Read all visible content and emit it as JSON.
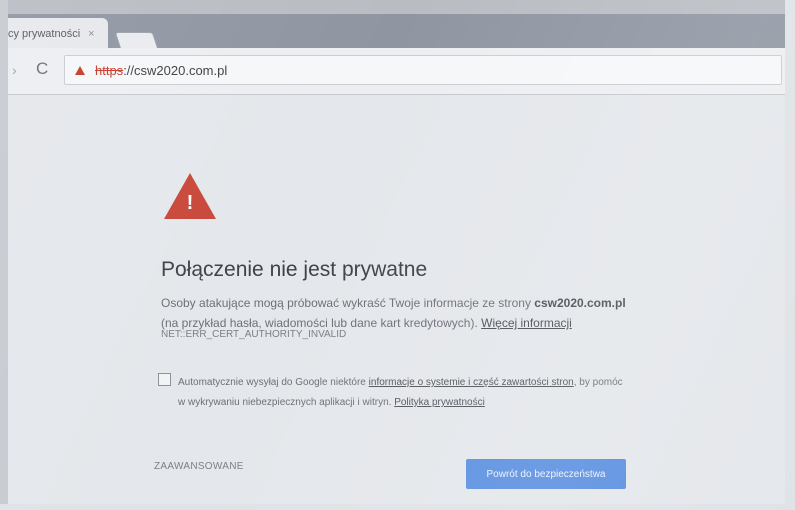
{
  "browser": {
    "tab_title": "cy prywatności",
    "tab_close": "×",
    "nav_forward": "›",
    "nav_reload": "C",
    "url_scheme": "https",
    "url_rest": "://csw2020.com.pl"
  },
  "page": {
    "heading": "Połączenie nie jest prywatne",
    "body_prefix": "Osoby atakujące mogą próbować wykraść Twoje informacje ze strony",
    "body_domain": "csw2020.com.pl",
    "body_suffix": "(na przykład hasła, wiadomości lub dane kart kredytowych).",
    "more_info_link": "Więcej informacji",
    "error_code": "NET::ERR_CERT_AUTHORITY_INVALID",
    "warning_mark": "!",
    "optin_prefix": "Automatycznie wysyłaj do Google niektóre",
    "optin_link": "informacje o systemie i część zawartości stron",
    "optin_middle": ", by pomóc w wykrywaniu niebezpiecznych aplikacji i witryn.",
    "privacy_link": "Polityka prywatności",
    "advanced_label": "ZAAWANSOWANE",
    "back_button": "Powrót do bezpieczeństwa"
  },
  "colors": {
    "warning": "#c9473a",
    "primary_button": "#5a8fe0"
  }
}
